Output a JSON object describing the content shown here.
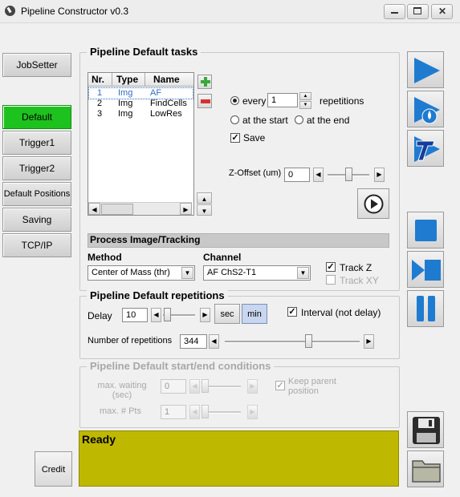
{
  "window": {
    "title": "Pipeline Constructor v0.3"
  },
  "nav": {
    "jobsetter": "JobSetter",
    "items": [
      "Default",
      "Trigger1",
      "Trigger2",
      "Default Positions",
      "Saving",
      "TCP/IP"
    ],
    "active": "Default",
    "credit": "Credit"
  },
  "tasks": {
    "title": "Pipeline Default tasks",
    "columns": [
      "Nr.",
      "Type",
      "Name"
    ],
    "rows": [
      {
        "nr": "1",
        "type": "Img",
        "name": "AF"
      },
      {
        "nr": "2",
        "type": "Img",
        "name": "FindCells"
      },
      {
        "nr": "3",
        "type": "Img",
        "name": "LowRes"
      }
    ],
    "every_label": "every",
    "every_value": "1",
    "repetitions_label": "repetitions",
    "at_start_label": "at the start",
    "at_end_label": "at the end",
    "save_label": "Save",
    "zoffset_label": "Z-Offset (um)",
    "zoffset_value": "0"
  },
  "process": {
    "header": "Process Image/Tracking",
    "method_label": "Method",
    "method_value": "Center of Mass (thr)",
    "channel_label": "Channel",
    "channel_value": "AF ChS2-T1",
    "trackz_label": "Track Z",
    "trackxy_label": "Track XY"
  },
  "repetitions": {
    "title": "Pipeline Default repetitions",
    "delay_label": "Delay",
    "delay_value": "10",
    "sec_label": "sec",
    "min_label": "min",
    "interval_label": "Interval (not delay)",
    "count_label": "Number of repetitions",
    "count_value": "344"
  },
  "conditions": {
    "title": "Pipeline Default start/end conditions",
    "max_wait_label": "max. waiting\n(sec)",
    "max_wait_value": "0",
    "max_pts_label": "max. # Pts",
    "max_pts_value": "1",
    "keep_parent_label": "Keep parent\nposition"
  },
  "status": {
    "text": "Ready",
    "color": "#bfb800"
  },
  "colors": {
    "accent_blue": "#1f7bd0",
    "active_green": "#1ec21e"
  }
}
